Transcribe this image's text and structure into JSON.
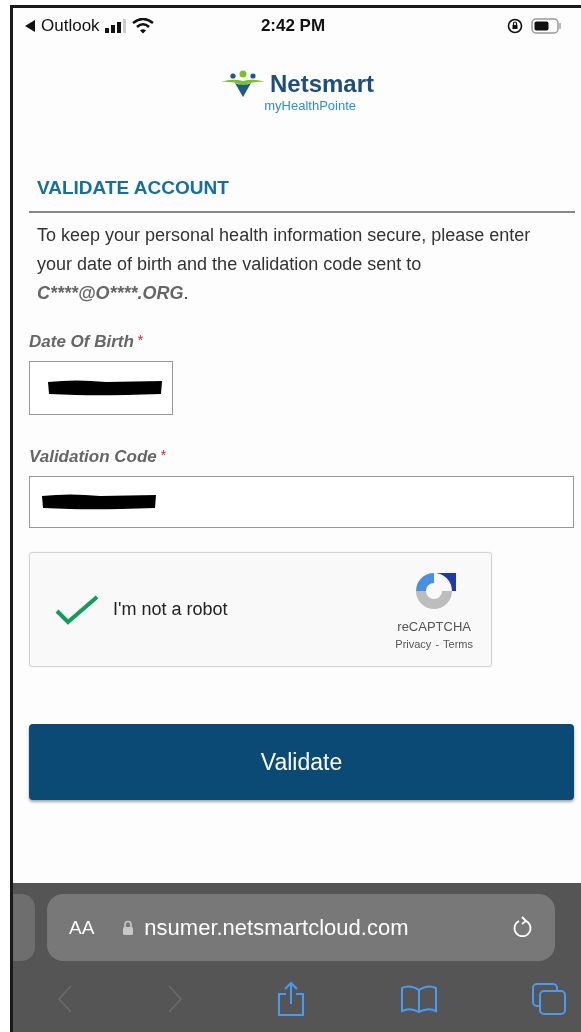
{
  "status_bar": {
    "back_app": "Outlook",
    "time": "2:42 PM"
  },
  "logo": {
    "name": "Netsmart",
    "subtitle": "myHealthPointe"
  },
  "title": "VALIDATE ACCOUNT",
  "intro": {
    "text": "To keep your personal health information secure, please enter your date of birth and the validation code sent to",
    "email": "C****@O****.ORG",
    "end": "."
  },
  "fields": [
    {
      "kind": "date",
      "label": "Date Of Birth",
      "required_mark": "*",
      "redacted": true
    },
    {
      "kind": "code",
      "label": "Validation Code",
      "required_mark": "*",
      "redacted": true
    }
  ],
  "captcha": {
    "checked": true,
    "label": "I'm not a robot",
    "brand": "reCAPTCHA",
    "links": [
      "Privacy",
      "Terms"
    ],
    "separator": "-"
  },
  "button": "Validate",
  "browser": {
    "text_size": "AA",
    "url": "nsumer.netsmartcloud.com",
    "back_disabled": true,
    "forward_disabled": true
  }
}
